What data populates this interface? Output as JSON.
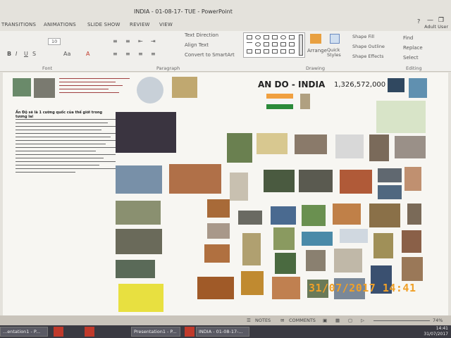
{
  "window": {
    "title": "INDIA - 01-08-17- TUE - PowerPoint",
    "help": "?",
    "user": "Adult User"
  },
  "tabs": [
    "TRANSITIONS",
    "ANIMATIONS",
    "SLIDE SHOW",
    "REVIEW",
    "VIEW"
  ],
  "ribbon": {
    "font_size": "10",
    "text_direction": "Text Direction",
    "align_text": "Align Text",
    "convert_smartart": "Convert to SmartArt",
    "arrange": "Arrange",
    "quick_styles": "Quick Styles",
    "shape_fill": "Shape Fill",
    "shape_outline": "Shape Outline",
    "shape_effects": "Shape Effects",
    "find": "Find",
    "replace": "Replace",
    "select": "Select",
    "groups": {
      "font": "Font",
      "paragraph": "Paragraph",
      "drawing": "Drawing",
      "editing": "Editing"
    }
  },
  "slide": {
    "heading": "AN DO - INDIA",
    "population": "1,326,572,000",
    "body_title": "Ấn Độ sẽ là 1 cường quốc của thế giới trong tương lai",
    "timestamp": "31/07/2017  14:41"
  },
  "status": {
    "notes": "NOTES",
    "comments": "COMMENTS",
    "zoom": "74%"
  },
  "taskbar": {
    "items": [
      "...entation1 - P...",
      "",
      "Presentation1 - P...",
      "INDIA - 01-08-17-..."
    ],
    "time": "14:41",
    "date": "31/07/2017"
  },
  "colors": {
    "accent": "#c03a2b",
    "stamp": "#f0a028",
    "statusbar": "#c9c4bb"
  }
}
